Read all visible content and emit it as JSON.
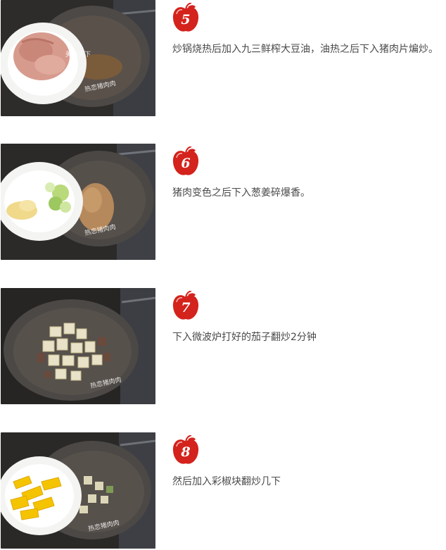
{
  "steps": [
    {
      "number": "5",
      "text": "炒锅烧热后加入九三鲜榨大豆油，油热之后下入猪肉片煸炒。",
      "photo": "raw pork slices on a plate beside a hot wok",
      "watermark": "美食天下",
      "signature": "热恋猪肉肉"
    },
    {
      "number": "6",
      "text": "猪肉变色之后下入葱姜碎爆香。",
      "photo": "chopped scallion and ginger on a plate beside browned pork in a wok",
      "signature": "热恋猪肉肉"
    },
    {
      "number": "7",
      "text": "下入微波炉打好的茄子翻炒2分钟",
      "photo": "cubed eggplant stir-frying in a wok",
      "signature": "热恋猪肉肉"
    },
    {
      "number": "8",
      "text": "然后加入彩椒块翻炒几下",
      "photo": "yellow bell pepper strips on a plate beside eggplant in a wok",
      "signature": "热恋猪肉肉"
    }
  ],
  "colors": {
    "badge_red": "#d4221c",
    "text": "#4a4a4a"
  }
}
